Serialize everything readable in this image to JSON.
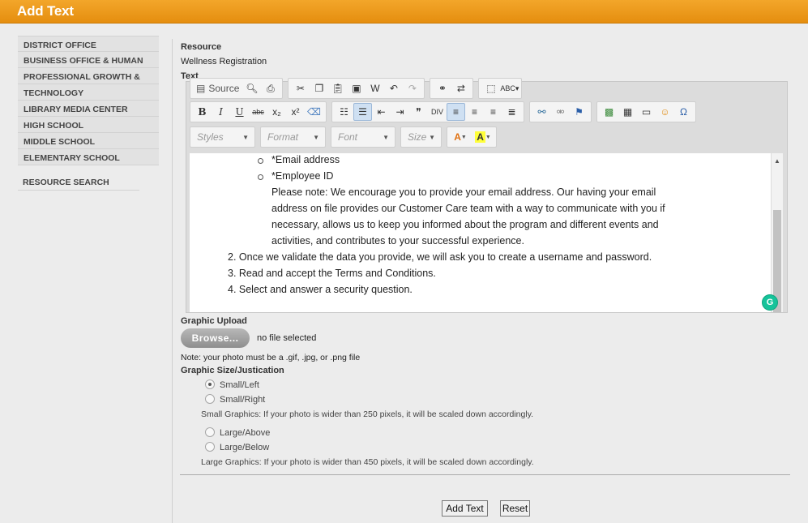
{
  "header": {
    "title": "Add Text"
  },
  "sidebar": {
    "items": [
      "DISTRICT OFFICE",
      "BUSINESS OFFICE & HUMAN",
      "PROFESSIONAL GROWTH &",
      "TECHNOLOGY",
      "LIBRARY MEDIA CENTER",
      "HIGH SCHOOL",
      "MIDDLE SCHOOL",
      "ELEMENTARY SCHOOL"
    ],
    "search": "RESOURCE SEARCH"
  },
  "form": {
    "resource_label": "Resource",
    "resource_value": "Wellness Registration",
    "text_label": "Text"
  },
  "toolbar": {
    "source": "Source",
    "styles": "Styles",
    "format": "Format",
    "font": "Font",
    "size": "Size"
  },
  "editor": {
    "bullets": [
      "*Email address",
      "*Employee ID"
    ],
    "note_lines": [
      "Please note: We encourage you to provide your email address. Our having your email",
      "address on file provides our Customer Care team with a way to communicate with you if",
      "necessary, allows us to keep you informed about the program and different events and",
      "activities, and contributes to your successful experience."
    ],
    "steps": [
      "2. Once we validate the data you provide, we will ask you to create a username and password.",
      "3. Read and accept the Terms and Conditions.",
      "4. Select and answer a security question."
    ]
  },
  "upload": {
    "label": "Graphic Upload",
    "browse": "Browse...",
    "status": "no file selected",
    "note": "Note: your photo must be a .gif, .jpg, or .png file"
  },
  "graphic_size": {
    "label": "Graphic Size/Justication",
    "options": [
      "Small/Left",
      "Small/Right",
      "Large/Above",
      "Large/Below"
    ],
    "selected": "Small/Left",
    "small_note": "Small Graphics: If your photo is wider than 250 pixels, it will be scaled down accordingly.",
    "large_note": "Large Graphics: If your photo is wider than 450 pixels, it will be scaled down accordingly."
  },
  "buttons": {
    "add": "Add Text",
    "reset": "Reset"
  },
  "colors": {
    "header": "#e8920f",
    "accent": "#15c39a"
  }
}
